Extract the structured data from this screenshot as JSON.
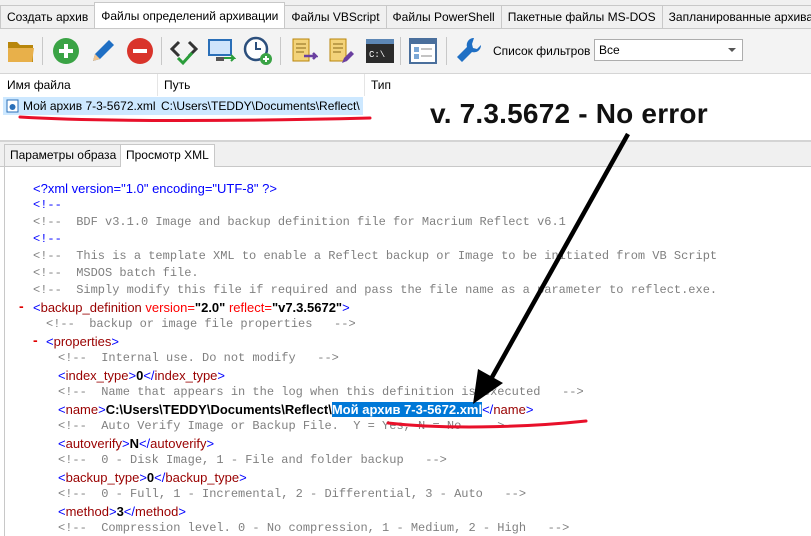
{
  "tabs": [
    {
      "label": "Создать архив",
      "active": false
    },
    {
      "label": "Файлы определений архивации",
      "active": true
    },
    {
      "label": "Файлы VBScript",
      "active": false
    },
    {
      "label": "Файлы PowerShell",
      "active": false
    },
    {
      "label": "Пакетные файлы MS-DOS",
      "active": false
    },
    {
      "label": "Запланированные архивации",
      "active": false
    }
  ],
  "toolbar": {
    "icons": [
      "folder-open-icon",
      "add-icon",
      "edit-icon",
      "delete-icon",
      "xml-check-icon",
      "monitor-arrow-icon",
      "clock-add-icon",
      "script-arrow-icon",
      "script-edit-icon",
      "command-prompt-icon",
      "window-settings-icon",
      "wrench-icon"
    ],
    "filter_label": "Список фильтров",
    "filter_value": "Все"
  },
  "list": {
    "columns": [
      "Имя файла",
      "Путь",
      "Тип"
    ],
    "rows": [
      {
        "name": "Мой архив 7-3-5672.xml",
        "path": "C:\\Users\\TEDDY\\Documents\\Reflect\\",
        "type": ""
      }
    ]
  },
  "subtabs": [
    {
      "label": "Параметры образа",
      "active": false
    },
    {
      "label": "Просмотр XML",
      "active": true
    }
  ],
  "annotation": "v. 7.3.5672 - No error",
  "xml": {
    "decl": "<?xml version=\"1.0\" encoding=\"UTF-8\" ?>",
    "c_open": "<!--",
    "c1": "<!--  BDF v3.1.0 Image and backup definition file for Macrium Reflect v6.1",
    "c_open2": "<!--",
    "c2": "<!--  This is a template XML to enable a Reflect backup or Image to be initiated from VB Script",
    "c3": "<!--  MSDOS batch file.",
    "c4": "<!--  Simply modify this file if required and pass the file name as a parameter to reflect.exe.",
    "bd_tag": "backup_definition",
    "bd_attr1": " version=",
    "bd_val1": "\"2.0\"",
    "bd_attr2": " reflect=",
    "bd_val2": "\"v7.3.5672\"",
    "c5": "<!--  backup or image file properties   -->",
    "props_tag": "properties",
    "c6": "<!--  Internal use. Do not modify   -->",
    "index_type": "0",
    "c7": "<!--  Name that appears in the log when this definition is executed   -->",
    "name_path": "C:\\Users\\TEDDY\\Documents\\Reflect\\",
    "name_file": "Мой архив 7-3-5672.xml",
    "c8": "<!--  Auto Verify Image or Backup File.  Y = Yes, N = No   -->",
    "autoverify": "N",
    "c9": "<!--  0 - Disk Image, 1 - File and folder backup   -->",
    "backup_type": "0",
    "c10": "<!--  0 - Full, 1 - Incremental, 2 - Differential, 3 - Auto   -->",
    "method": "3",
    "c11": "<!--  Compression level. 0 - No compression, 1 - Medium, 2 - High   -->"
  }
}
